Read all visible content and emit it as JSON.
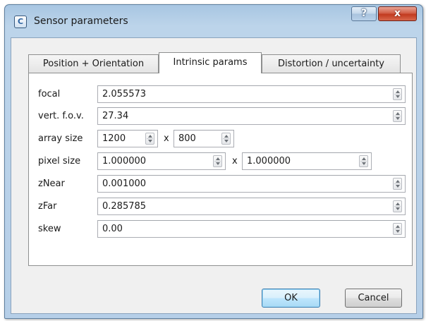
{
  "window": {
    "title": "Sensor parameters",
    "app_icon_glyph": "C",
    "help_glyph": "?",
    "close_glyph": "x"
  },
  "tabs": [
    {
      "label": "Position + Orientation",
      "active": false
    },
    {
      "label": "Intrinsic params",
      "active": true
    },
    {
      "label": "Distortion / uncertainty",
      "active": false
    }
  ],
  "params": {
    "focal": {
      "label": "focal",
      "value": "2.055573"
    },
    "vfov": {
      "label": "vert. f.o.v.",
      "value": "27.34"
    },
    "array_size": {
      "label": "array size",
      "width": "1200",
      "height": "800",
      "sep": "x"
    },
    "pixel_size": {
      "label": "pixel size",
      "x": "1.000000",
      "y": "1.000000",
      "sep": "x"
    },
    "znear": {
      "label": "zNear",
      "value": "0.001000"
    },
    "zfar": {
      "label": "zFar",
      "value": "0.285785"
    },
    "skew": {
      "label": "skew",
      "value": "0.00"
    }
  },
  "buttons": {
    "ok": "OK",
    "cancel": "Cancel"
  },
  "colors": {
    "titlebar": "#b6cfe8",
    "close_button": "#c23a1f",
    "default_button_border": "#3c7fb1",
    "dialog_background": "#f0f0f0"
  }
}
